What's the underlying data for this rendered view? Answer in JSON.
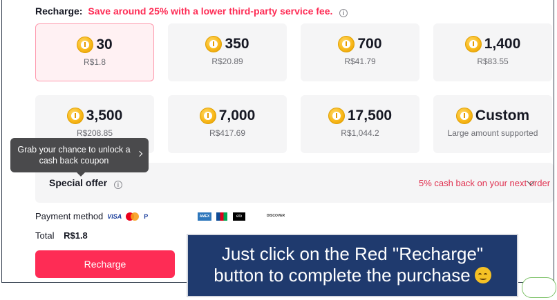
{
  "header": {
    "label": "Recharge:",
    "promo": "Save around 25% with a lower third-party service fee.",
    "info_icon": "i"
  },
  "packages": [
    {
      "amount": "30",
      "price": "R$1.8",
      "selected": true
    },
    {
      "amount": "350",
      "price": "R$20.89"
    },
    {
      "amount": "700",
      "price": "R$41.79"
    },
    {
      "amount": "1,400",
      "price": "R$83.55"
    },
    {
      "amount": "3,500",
      "price": "R$208.85"
    },
    {
      "amount": "7,000",
      "price": "R$417.69"
    },
    {
      "amount": "17,500",
      "price": "R$1,044.2"
    },
    {
      "amount": "Custom",
      "price": "Large amount supported"
    }
  ],
  "tooltip": {
    "text": "Grab your chance to unlock a cash back coupon"
  },
  "special_offer": {
    "title": "Special offer",
    "cashback": "5% cash back on your next order"
  },
  "payment": {
    "label": "Payment method",
    "logos": {
      "visa": "VISA",
      "paypal": "P",
      "amex": "AMEX",
      "elo": "elo",
      "discover": "DISCOVER"
    }
  },
  "total": {
    "label": "Total",
    "value": "R$1.8"
  },
  "recharge_button": "Recharge",
  "callout": {
    "line1": "Just click on the Red \"Recharge\"",
    "line2": "button to complete the purchase"
  },
  "colors": {
    "accent": "#fe2c55",
    "callout_bg": "#1f3a6e",
    "coin": "#f9b91b"
  }
}
